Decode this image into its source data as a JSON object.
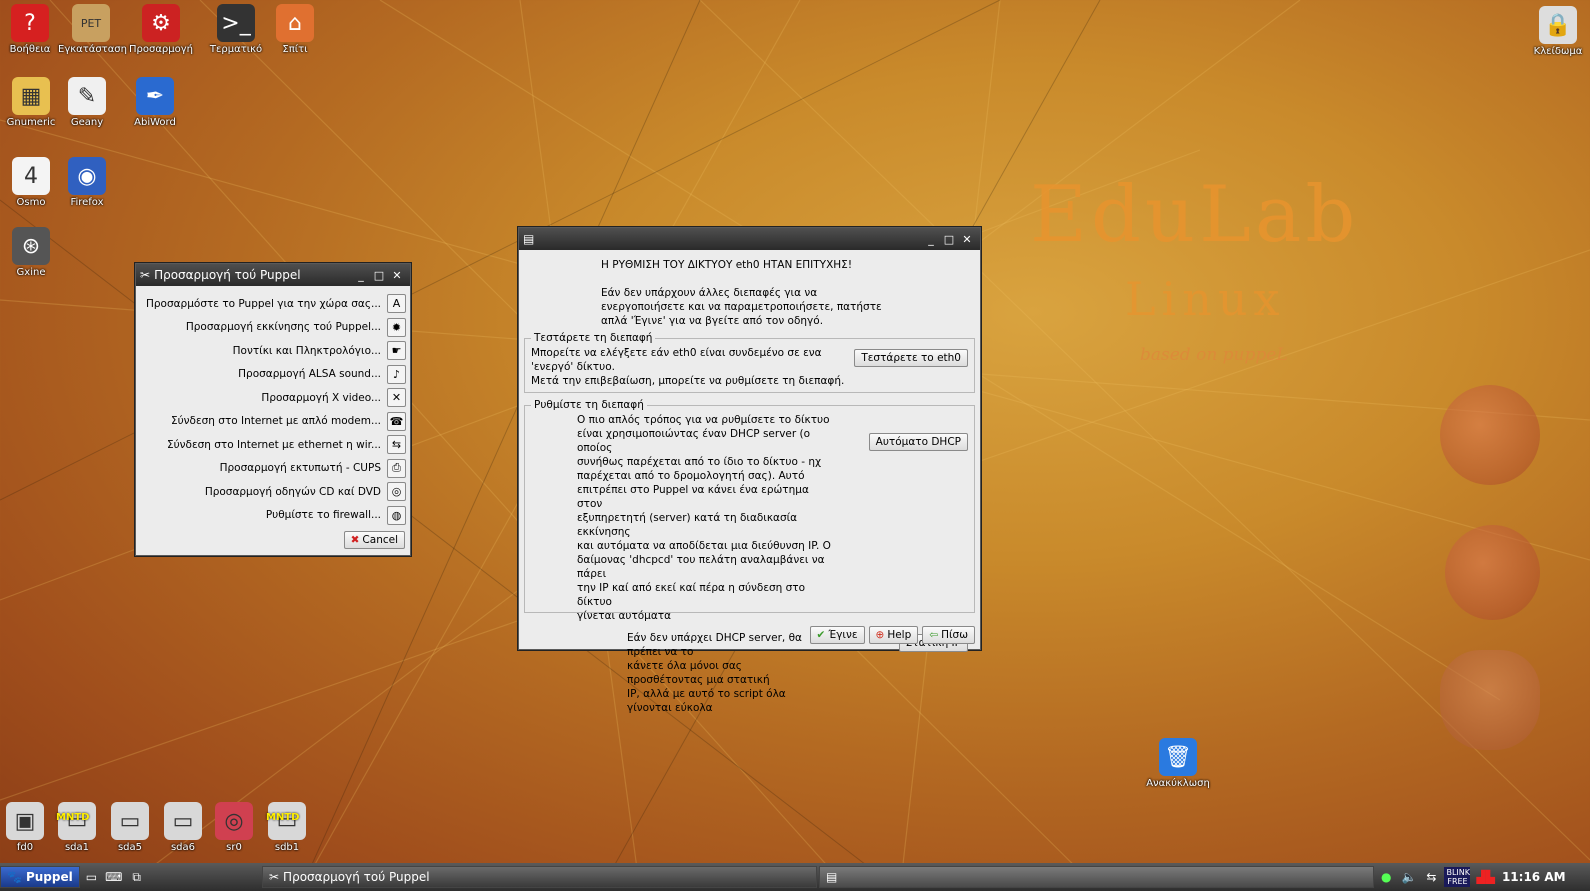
{
  "desktop": {
    "icons": [
      {
        "label": "Βοήθεια",
        "icon": "help-icon",
        "glyph": "?",
        "color": "#d62020"
      },
      {
        "label": "Εγκατάσταση",
        "icon": "install-icon",
        "glyph": "PET",
        "color": "#c8a060"
      },
      {
        "label": "Προσαρμογή",
        "icon": "setup-icon",
        "glyph": "⚙",
        "color": "#cc2222"
      },
      {
        "label": "Τερματικό",
        "icon": "terminal-icon",
        "glyph": ">_",
        "color": "#333333"
      },
      {
        "label": "Σπίτι",
        "icon": "home-icon",
        "glyph": "⌂",
        "color": "#e07030"
      },
      {
        "label": "Gnumeric",
        "icon": "spreadsheet-icon",
        "glyph": "▦",
        "color": "#e8c050"
      },
      {
        "label": "Geany",
        "icon": "editor-icon",
        "glyph": "✎",
        "color": "#f0f0f0"
      },
      {
        "label": "AbiWord",
        "icon": "wordprocessor-icon",
        "glyph": "✒",
        "color": "#2a6ad0"
      },
      {
        "label": "Osmo",
        "icon": "calendar-icon",
        "glyph": "4",
        "color": "#f4f4f4"
      },
      {
        "label": "Firefox",
        "icon": "browser-icon",
        "glyph": "◉",
        "color": "#3060c0"
      },
      {
        "label": "Gxine",
        "icon": "media-player-icon",
        "glyph": "⊛",
        "color": "#555555"
      },
      {
        "label": "Ανακύκλωση",
        "icon": "trash-icon",
        "glyph": "🗑",
        "color": "#2a7ae0"
      }
    ],
    "lock_label": "Κλείδωμα",
    "drives": [
      {
        "label": "fd0",
        "icon": "floppy-icon",
        "badge": ""
      },
      {
        "label": "sda1",
        "icon": "harddisk-icon",
        "badge": "MNTD"
      },
      {
        "label": "sda5",
        "icon": "harddisk-icon",
        "badge": ""
      },
      {
        "label": "sda6",
        "icon": "harddisk-icon",
        "badge": ""
      },
      {
        "label": "sr0",
        "icon": "cdrom-icon",
        "badge": ""
      },
      {
        "label": "sdb1",
        "icon": "usb-drive-icon",
        "badge": "MNTD"
      }
    ],
    "wallpaper": {
      "line1": "EduLab",
      "line2": "Linux",
      "line3": "based on puppeL"
    }
  },
  "puppel_window": {
    "title": "Προσαρμογή τού Puppel",
    "items": [
      {
        "label": "Προσαρμόστε το Puppel για την χώρα σας...",
        "icon": "keyboard-layout-icon",
        "glyph": "A"
      },
      {
        "label": "Προσαρμογή εκκίνησης τού Puppel...",
        "icon": "boot-icon",
        "glyph": "✹"
      },
      {
        "label": "Ποντίκι και Πληκτρολόγιο...",
        "icon": "mouse-icon",
        "glyph": "☛"
      },
      {
        "label": "Προσαρμογή ALSA sound...",
        "icon": "sound-icon",
        "glyph": "♪"
      },
      {
        "label": "Προσαρμογή X video...",
        "icon": "video-icon",
        "glyph": "✕"
      },
      {
        "label": "Σύνδεση στο Internet με απλό modem...",
        "icon": "modem-icon",
        "glyph": "☎"
      },
      {
        "label": "Σύνδεση στο Internet με ethernet η wir...",
        "icon": "network-icon",
        "glyph": "⇆"
      },
      {
        "label": "Προσαρμογή εκτυπωτή - CUPS",
        "icon": "printer-icon",
        "glyph": "⎙"
      },
      {
        "label": "Προσαρμογή οδηγών CD καί DVD",
        "icon": "disc-icon",
        "glyph": "◎"
      },
      {
        "label": "Ρυθμίστε το firewall...",
        "icon": "firewall-icon",
        "glyph": "◍"
      }
    ],
    "cancel_label": "Cancel"
  },
  "net_window": {
    "title": "",
    "heading": "Η ΡΥΘΜΙΣΗ ΤΟΥ ΔΙΚΤΥΟΥ eth0 ΗΤΑΝ ΕΠΙΤΥΧΗΣ!",
    "intro_lines": [
      "Εάν δεν υπάρχουν άλλες διεπαφές για να",
      "ενεργοποιήσετε και να παραμετροποιήσετε, πατήστε",
      "απλά 'Έγινε' για να βγείτε από τον οδηγό."
    ],
    "test_legend": "Τεστάρετε τη διεπαφή",
    "test_lines": [
      "Μπορείτε να ελέγξετε εάν eth0 είναι συνδεμένο σε ενα",
      "'ενεργό' δίκτυο."
    ],
    "test_after": "Μετά την επιβεβαίωση, μπορείτε να ρυθμίσετε τη διεπαφή.",
    "test_button": "Τεστάρετε το eth0",
    "config_legend": "Ρυθμίστε τη διεπαφή",
    "dhcp_lines": [
      "Ο πιο απλός τρόπος για να ρυθμίσετε το δίκτυο",
      "είναι χρησιμοποιώντας έναν DHCP server (ο οποίος",
      "συνήθως παρέχεται από το ίδιο το δίκτυο - ηχ",
      "παρέχεται από το δρομολογητή σας). Αυτό",
      "επιτρέπει στο Puppel να κάνει ένα ερώτημα στον",
      "εξυπηρετητή (server) κατά τη διαδικασία εκκίνησης",
      "και αυτόματα να αποδίδεται μια διεύθυνση IP. Ο",
      "δαίμονας 'dhcpcd' του πελάτη αναλαμβάνει να πάρει",
      "την IP καί από εκεί καί πέρα η σύνδεση στο δίκτυο",
      "γίνεται αυτόματα"
    ],
    "dhcp_button": "Αυτόματο DHCP",
    "static_lines": [
      "Εάν δεν υπάρχει DHCP server, θα πρέπει να το",
      "κάνετε όλα μόνοι σας προσθέτοντας μια στατική",
      "IP, αλλά με αυτό το script όλα γίνονται εύκολα"
    ],
    "static_button": "Στατική IP",
    "done_button": "Έγινε",
    "help_button": "Help",
    "back_button": "Πίσω"
  },
  "taskbar": {
    "menu_label": "Puppel",
    "task1": "Προσαρμογή τού Puppel",
    "task2": "",
    "clock": "11:16 AM",
    "tray_badge": "BLINK FREE"
  }
}
